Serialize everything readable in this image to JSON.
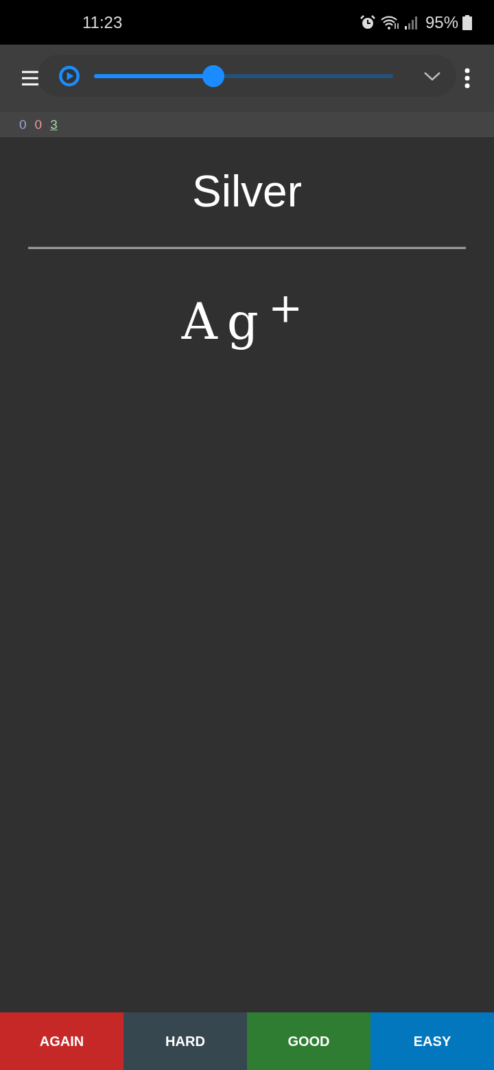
{
  "status_bar": {
    "time": "11:23",
    "battery": "95%"
  },
  "audio_player": {
    "level": 0.4
  },
  "counts": [
    {
      "value": "0",
      "color": "#9fa8da",
      "selected": false
    },
    {
      "value": "0",
      "color": "#ef9a9a",
      "selected": false
    },
    {
      "value": "3",
      "color": "#a5d6a7",
      "selected": true
    }
  ],
  "card": {
    "front": "Silver",
    "back": "Ag$^{+}$"
  },
  "answer_buttons": [
    {
      "label": "AGAIN",
      "color": "#c62828"
    },
    {
      "label": "HARD",
      "color": "#37474f"
    },
    {
      "label": "GOOD",
      "color": "#2e7d32"
    },
    {
      "label": "EASY",
      "color": "#0277bd"
    }
  ]
}
